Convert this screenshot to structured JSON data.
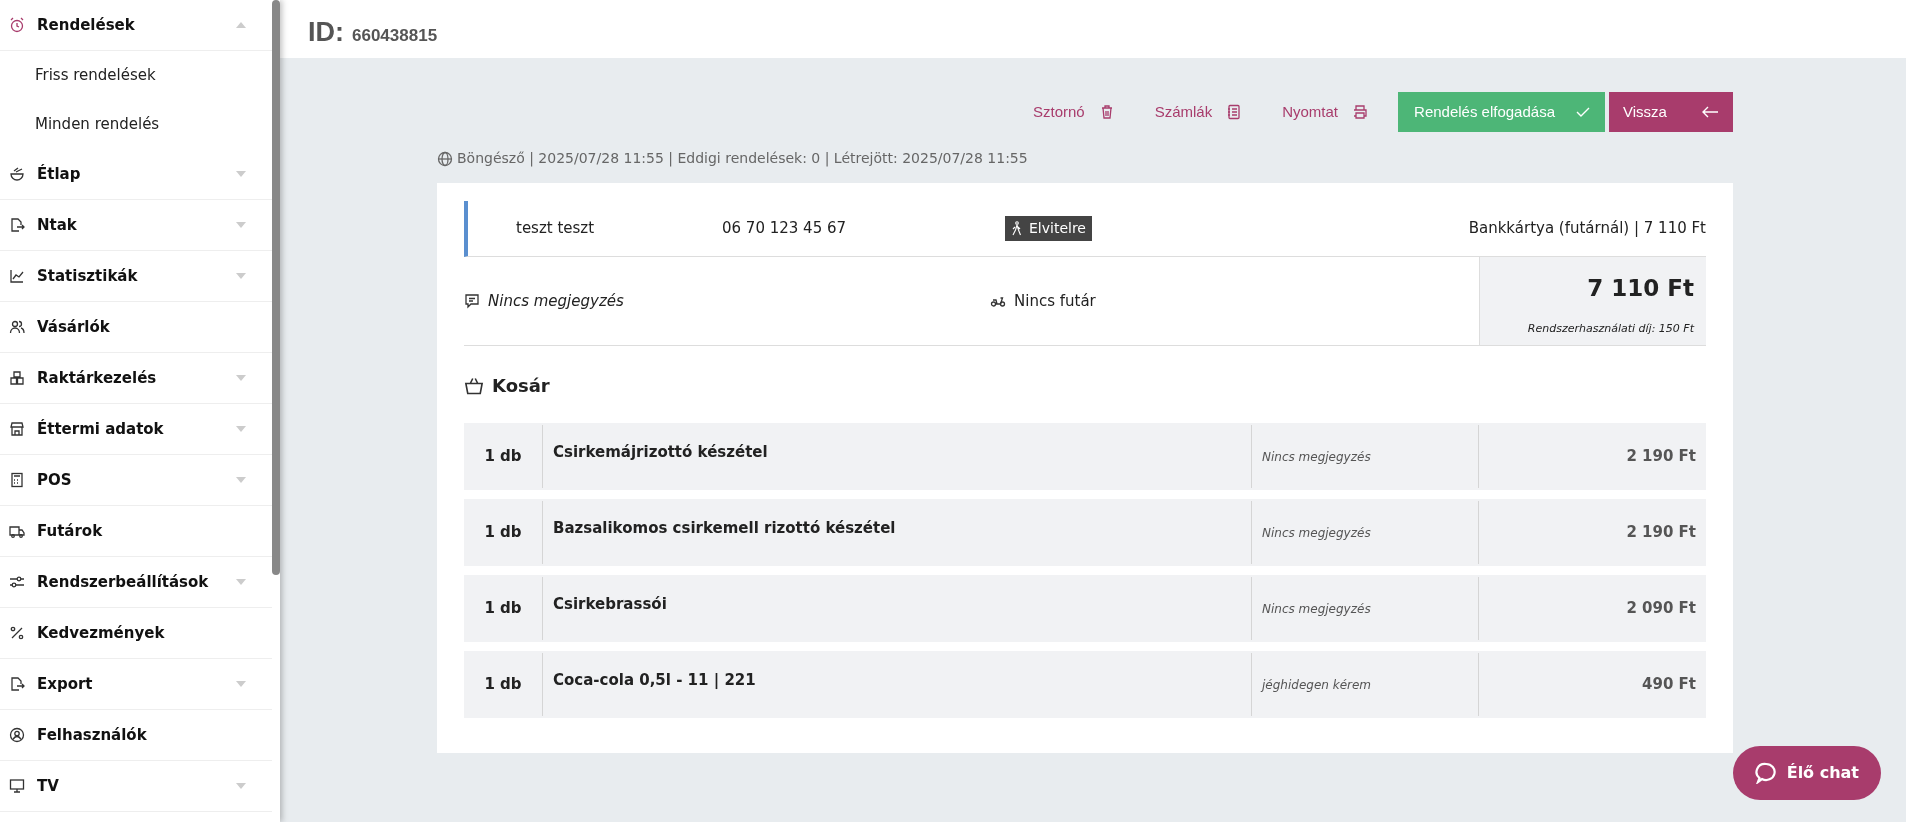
{
  "sidebar": {
    "items": [
      {
        "label": "Rendelések",
        "selected": true,
        "expanded": true,
        "children": [
          {
            "label": "Friss rendelések"
          },
          {
            "label": "Minden rendelés"
          }
        ]
      },
      {
        "label": "Étlap",
        "selected": false,
        "expanded": false
      },
      {
        "label": "Ntak",
        "selected": false,
        "expanded": false
      },
      {
        "label": "Statisztikák",
        "selected": false,
        "expanded": false
      },
      {
        "label": "Vásárlók",
        "selected": false
      },
      {
        "label": "Raktárkezelés",
        "selected": false,
        "expanded": false
      },
      {
        "label": "Éttermi adatok",
        "selected": false,
        "expanded": false
      },
      {
        "label": "POS",
        "selected": false,
        "expanded": false
      },
      {
        "label": "Futárok",
        "selected": false
      },
      {
        "label": "Rendszerbeállítások",
        "selected": false,
        "expanded": false
      },
      {
        "label": "Kedvezmények",
        "selected": false
      },
      {
        "label": "Export",
        "selected": false,
        "expanded": false
      },
      {
        "label": "Felhasználók",
        "selected": false
      },
      {
        "label": "TV",
        "selected": false,
        "expanded": false
      }
    ]
  },
  "header": {
    "id_label": "ID:",
    "id_value": "660438815"
  },
  "actions": [
    {
      "label": "Sztornó",
      "kind": "link"
    },
    {
      "label": "Számlák",
      "kind": "link"
    },
    {
      "label": "Nyomtat",
      "kind": "link"
    },
    {
      "label": "Rendelés elfogadása",
      "kind": "accept"
    },
    {
      "label": "Vissza",
      "kind": "back"
    }
  ],
  "meta": "Böngésző | 2025/07/28 11:55 | Eddigi rendelések: 0 | Létrejött: 2025/07/28 11:55",
  "order": {
    "customer": "teszt teszt",
    "phone": "06 70 123 45 67",
    "delivery_type": "Elvitelre",
    "payment": "Bankkártya (futárnál) | 7 110 Ft",
    "note": "Nincs megjegyzés",
    "courier": "Nincs futár",
    "total": "7 110 Ft",
    "fee": "Rendszerhasználati díj: 150 Ft"
  },
  "cart": {
    "title": "Kosár",
    "items": [
      {
        "qty": "1 db",
        "name": "Csirkemájrizottó készétel",
        "note": "Nincs megjegyzés",
        "price": "2 190 Ft"
      },
      {
        "qty": "1 db",
        "name": "Bazsalikomos csirkemell rizottó készétel",
        "note": "Nincs megjegyzés",
        "price": "2 190 Ft"
      },
      {
        "qty": "1 db",
        "name": "Csirkebrassói",
        "note": "Nincs megjegyzés",
        "price": "2 090 Ft"
      },
      {
        "qty": "1 db",
        "name": "Coca-cola 0,5l - 11 | 221",
        "note": "jéghidegen kérem",
        "price": "490 Ft"
      }
    ]
  },
  "chat": {
    "label": "Élő chat"
  }
}
